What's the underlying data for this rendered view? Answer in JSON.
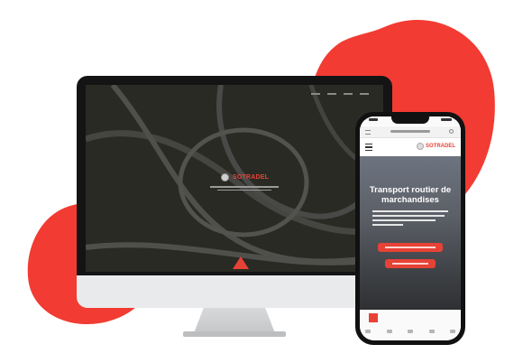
{
  "scene": {
    "accent_color": "#e74236",
    "background_color": "#ffffff"
  },
  "desktop": {
    "brand_name": "SOTRADEL",
    "icons": [
      "logo-icon",
      "scroll-arrow-icon"
    ]
  },
  "mobile": {
    "brand_name": "SOTRADEL",
    "hero_title": "Transport routier de marchandises",
    "icons": [
      "menu-icon",
      "logo-icon",
      "refresh-icon"
    ]
  }
}
